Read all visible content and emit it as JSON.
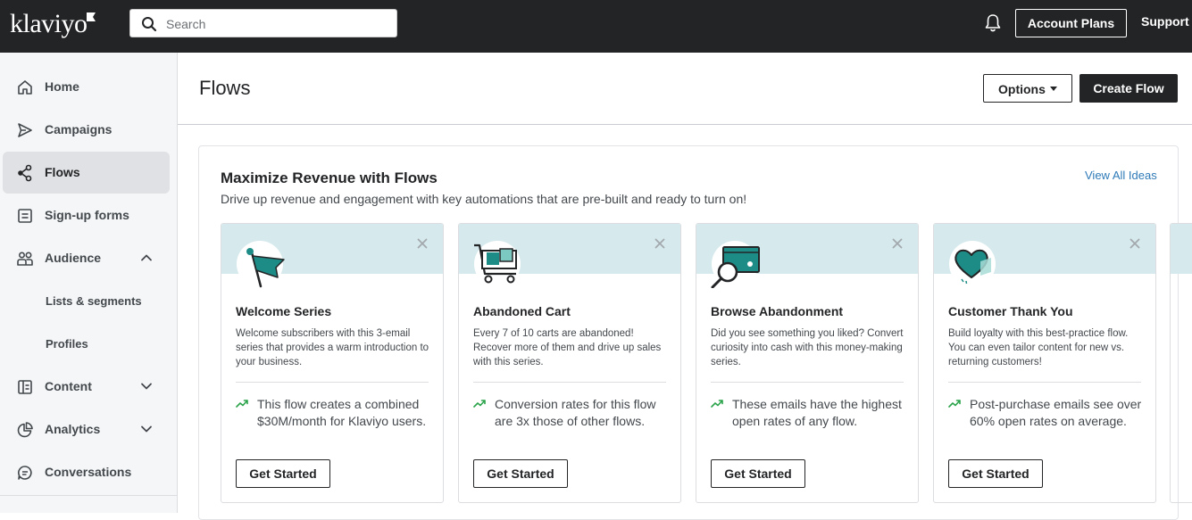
{
  "brand": {
    "logo_text": "klaviyo"
  },
  "topbar": {
    "search_placeholder": "Search",
    "account_plans": "Account Plans",
    "support": "Support"
  },
  "sidebar": {
    "items": [
      {
        "label": "Home",
        "icon": "home-icon"
      },
      {
        "label": "Campaigns",
        "icon": "send-icon"
      },
      {
        "label": "Flows",
        "icon": "flows-icon",
        "active": true
      },
      {
        "label": "Sign-up forms",
        "icon": "form-icon"
      },
      {
        "label": "Audience",
        "icon": "people-icon",
        "expanded": true
      },
      {
        "label": "Content",
        "icon": "content-icon"
      },
      {
        "label": "Analytics",
        "icon": "analytics-icon"
      },
      {
        "label": "Conversations",
        "icon": "chat-icon"
      }
    ],
    "audience_sub": [
      "Lists & segments",
      "Profiles"
    ]
  },
  "page": {
    "title": "Flows",
    "options_label": "Options",
    "create_label": "Create Flow"
  },
  "ideas": {
    "title": "Maximize Revenue with Flows",
    "subtitle": "Drive up revenue and engagement with key automations that are pre-built and ready to turn on!",
    "view_all": "View All Ideas",
    "cards": [
      {
        "title": "Welcome Series",
        "description": "Welcome subscribers with this 3-email series that provides a warm introduction to your business.",
        "stat": "This flow creates a combined $30M/month for Klaviyo users.",
        "button": "Get Started",
        "icon": "flag-icon"
      },
      {
        "title": "Abandoned Cart",
        "description": "Every 7 of 10 carts are abandoned! Recover more of them and drive up sales with this series.",
        "stat": "Conversion rates for this flow are 3x those of other flows.",
        "button": "Get Started",
        "icon": "cart-icon"
      },
      {
        "title": "Browse Abandonment",
        "description": "Did you see something you liked? Convert curiosity into cash with this money-making series.",
        "stat": "These emails have the highest open rates of any flow.",
        "button": "Get Started",
        "icon": "browse-magnifier-icon"
      },
      {
        "title": "Customer Thank You",
        "description": "Build loyalty with this best-practice flow. You can even tailor content for new vs. returning customers!",
        "stat": "Post-purchase emails see over 60% open rates on average.",
        "button": "Get Started",
        "icon": "heart-icon"
      }
    ]
  },
  "colors": {
    "topbar": "#232426",
    "accent_teal": "#1e8c86",
    "band": "#d6eaee",
    "link": "#2e7ab8",
    "trend_green": "#2aa34a"
  }
}
